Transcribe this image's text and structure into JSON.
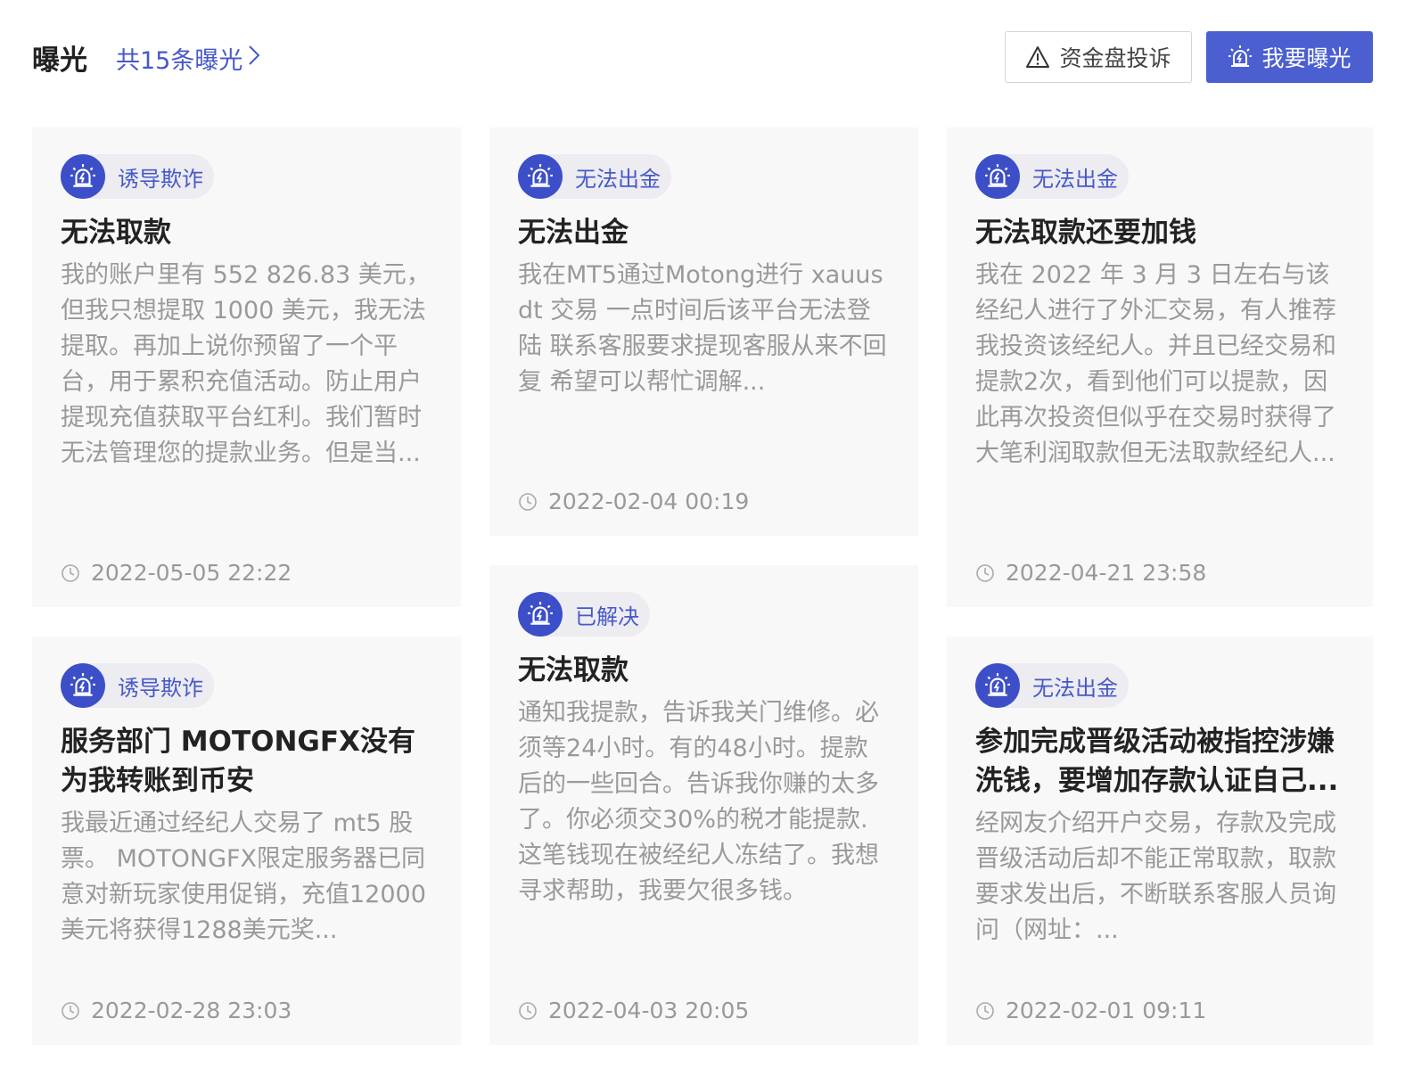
{
  "header": {
    "title": "曝光",
    "count_link": "共15条曝光",
    "complaint_button": "资金盘投诉",
    "expose_button": "我要曝光"
  },
  "cards": [
    {
      "tag": "诱导欺诈",
      "title": "无法取款",
      "body": "我的账户里有 552 826.83 美元，但我只想提取 1000 美元，我无法提取。再加上说你预留了一个平台，用于累积充值活动。防止用户提现充值获取平台红利。我们暂时无法管理您的提款业务。但是当...",
      "time": "2022-05-05 22:22"
    },
    {
      "tag": "无法出金",
      "title": "无法出金",
      "body": "我在MT5通过Motong进行 xauusdt 交易 一点时间后该平台无法登陆 联系客服要求提现客服从来不回复 希望可以帮忙调解...",
      "time": "2022-02-04 00:19"
    },
    {
      "tag": "无法出金",
      "title": "无法取款还要加钱",
      "body": "我在 2022 年 3 月 3 日左右与该经纪人进行了外汇交易，有人推荐我投资该经纪人。并且已经交易和提款2次，看到他们可以提款，因此再次投资但似乎在交易时获得了大笔利润取款但无法取款经纪人...",
      "time": "2022-04-21 23:58"
    },
    {
      "tag": "诱导欺诈",
      "title": "服务部门 MOTONGFX没有为我转账到币安",
      "body": "我最近通过经纪人交易了 mt5 股票。 MOTONGFX限定服务器已同意对新玩家使用促销，充值12000美元将获得1288美元奖...",
      "time": "2022-02-28 23:03"
    },
    {
      "tag": "已解决",
      "title": "无法取款",
      "body": "通知我提款，告诉我关门维修。必须等24小时。有的48小时。提款后的一些回合。告诉我你赚的太多了。你必须交30%的税才能提款.这笔钱现在被经纪人冻结了。我想寻求帮助，我要欠很多钱。",
      "time": "2022-04-03 20:05"
    },
    {
      "tag": "无法出金",
      "title": "参加完成晋级活动被指控涉嫌洗钱，要增加存款认证自己...",
      "body": "经网友介绍开户交易，存款及完成晋级活动后却不能正常取款，取款要求发出后，不断联系客服人员询问（网址：...",
      "time": "2022-02-01 09:11"
    }
  ]
}
